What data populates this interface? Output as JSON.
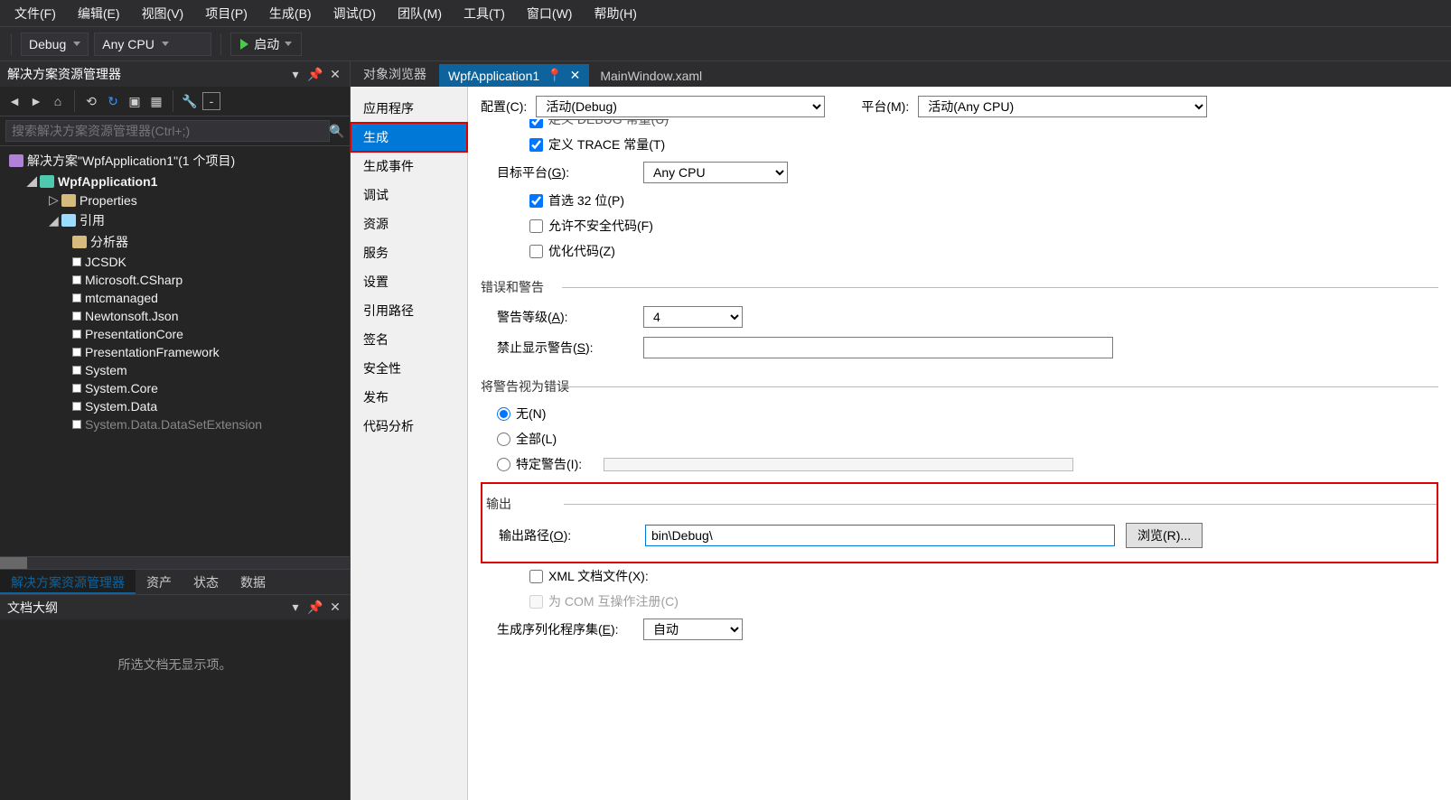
{
  "menu": {
    "items": [
      "文件(F)",
      "编辑(E)",
      "视图(V)",
      "项目(P)",
      "生成(B)",
      "调试(D)",
      "团队(M)",
      "工具(T)",
      "窗口(W)",
      "帮助(H)"
    ]
  },
  "toolbar": {
    "config": "Debug",
    "platform": "Any CPU",
    "start_label": "启动"
  },
  "sol_explorer": {
    "title": "解决方案资源管理器",
    "search_placeholder": "搜索解决方案资源管理器(Ctrl+;)",
    "solution": "解决方案\"WpfApplication1\"(1 个项目)",
    "project": "WpfApplication1",
    "properties": "Properties",
    "references": "引用",
    "ref_items": [
      "分析器",
      "JCSDK",
      "Microsoft.CSharp",
      "mtcmanaged",
      "Newtonsoft.Json",
      "PresentationCore",
      "PresentationFramework",
      "System",
      "System.Core",
      "System.Data",
      "System.Data.DataSetExtension"
    ]
  },
  "panel_tabs": [
    "解决方案资源管理器",
    "资产",
    "状态",
    "数据"
  ],
  "outline": {
    "title": "文档大纲",
    "empty": "所选文档无显示项。"
  },
  "editor_tabs": {
    "obj_browser": "对象浏览器",
    "active": "WpfApplication1",
    "second": "MainWindow.xaml"
  },
  "prop_nav": [
    "应用程序",
    "生成",
    "生成事件",
    "调试",
    "资源",
    "服务",
    "设置",
    "引用路径",
    "签名",
    "安全性",
    "发布",
    "代码分析"
  ],
  "cfg_row": {
    "config_label": "配置(C):",
    "config_value": "活动(Debug)",
    "plat_label": "平台(M):",
    "plat_value": "活动(Any CPU)"
  },
  "build": {
    "debug_const": "定义 DEBUG 常量(U)",
    "trace_const": "定义 TRACE 常量(T)",
    "target_label": "目标平台(G):",
    "target_value": "Any CPU",
    "prefer32": "首选 32 位(P)",
    "unsafe": "允许不安全代码(F)",
    "optimize": "优化代码(Z)",
    "errwarn_group": "错误和警告",
    "warn_level_label": "警告等级(A):",
    "warn_level_value": "4",
    "suppress_label": "禁止显示警告(S):",
    "treat_group": "将警告视为错误",
    "none": "无(N)",
    "all": "全部(L)",
    "specific": "特定警告(I):",
    "output_group": "输出",
    "output_path_label": "输出路径(O):",
    "output_path_value": "bin\\Debug\\",
    "browse": "浏览(R)...",
    "xmldoc": "XML 文档文件(X):",
    "com": "为 COM 互操作注册(C)",
    "ser_label": "生成序列化程序集(E):",
    "ser_value": "自动"
  }
}
